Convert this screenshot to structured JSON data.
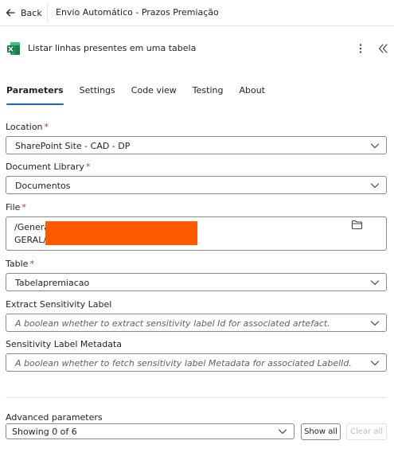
{
  "topbar": {
    "back_label": "Back",
    "flow_title": "Envio Automático - Prazos Premiação"
  },
  "action": {
    "title": "Listar linhas presentes em uma tabela",
    "icon": "excel-icon"
  },
  "tabs": [
    {
      "label": "Parameters",
      "active": true
    },
    {
      "label": "Settings",
      "active": false
    },
    {
      "label": "Code view",
      "active": false
    },
    {
      "label": "Testing",
      "active": false
    },
    {
      "label": "About",
      "active": false
    }
  ],
  "fields": {
    "location": {
      "label": "Location",
      "required": "*",
      "value": "SharePoint Site - CAD - DP"
    },
    "library": {
      "label": "Document Library",
      "required": "*",
      "value": "Documentos"
    },
    "file": {
      "label": "File",
      "required": "*",
      "line1": "/Genera",
      "line2": "GERAL/2"
    },
    "table": {
      "label": "Table",
      "required": "*",
      "value": "Tabelapremiacao"
    },
    "sensitivity": {
      "label": "Extract Sensitivity Label",
      "placeholder": "A boolean whether to extract sensitivity label Id for associated artefact."
    },
    "metadata": {
      "label": "Sensitivity Label Metadata",
      "placeholder": "A boolean whether to fetch sensitivity label Metadata for associated LabelId."
    }
  },
  "advanced": {
    "label": "Advanced parameters",
    "value": "Showing 0 of 6",
    "show_all": "Show all",
    "clear_all": "Clear all"
  },
  "colors": {
    "accent": "#0f6cbd",
    "required": "#c4314b",
    "excel_green": "#107c41",
    "redaction": "#ff5a00"
  }
}
